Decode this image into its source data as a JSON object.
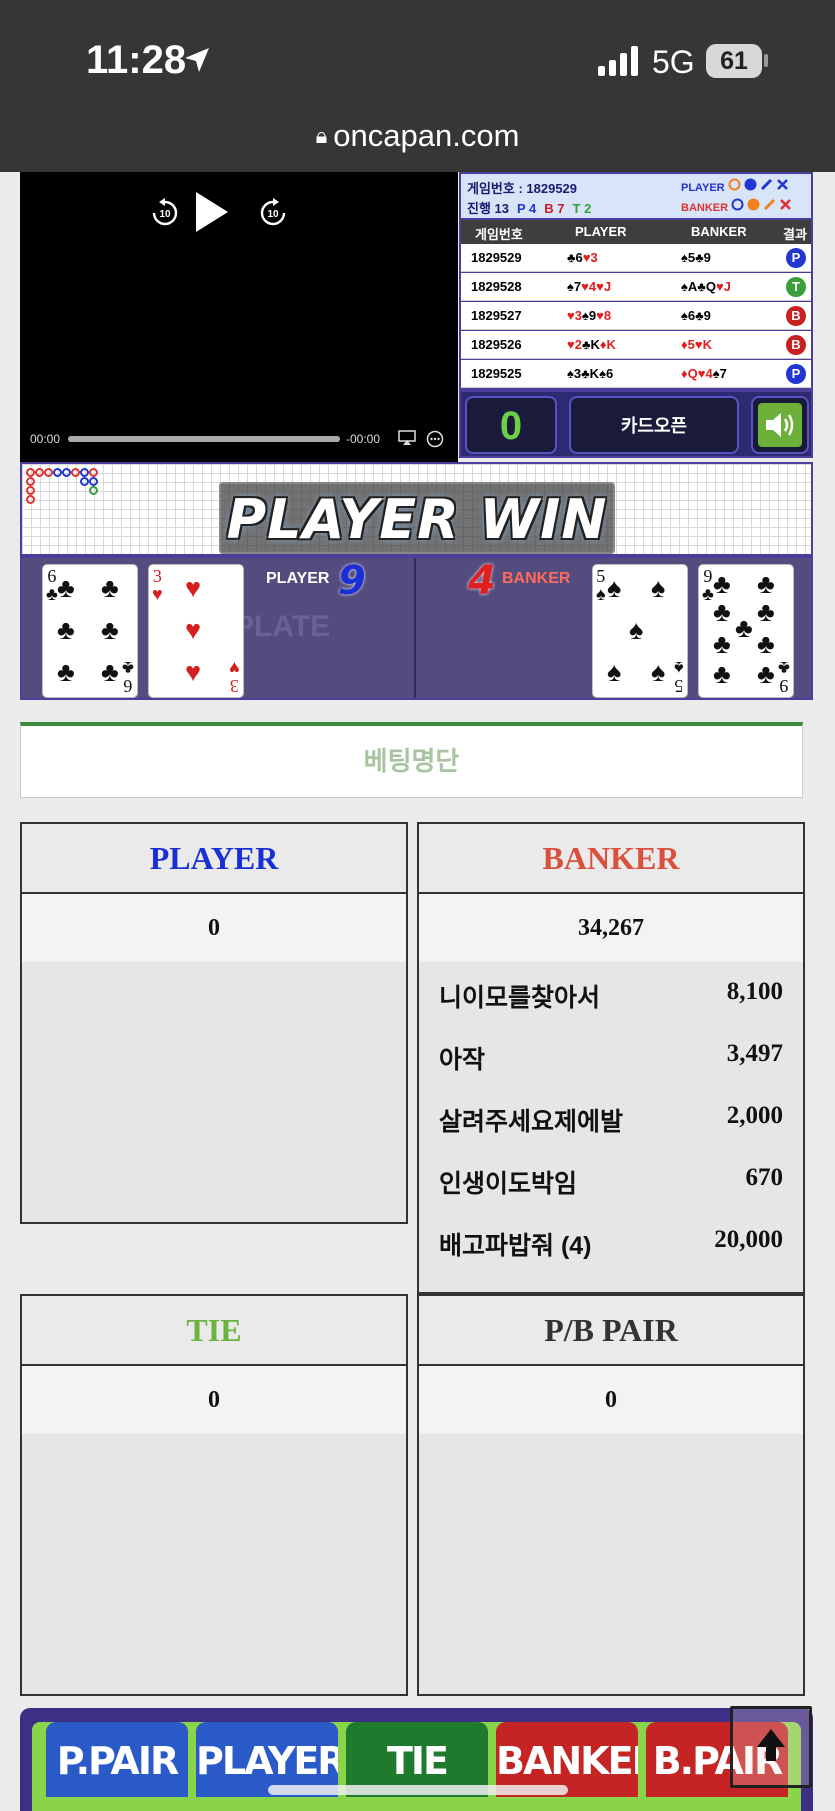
{
  "status": {
    "time": "11:28",
    "network": "5G",
    "battery": "61"
  },
  "browser": {
    "url": "oncapan.com"
  },
  "video": {
    "time_current": "00:00",
    "time_remaining": "-00:00",
    "skip_back": "10",
    "skip_forward": "10"
  },
  "panel": {
    "game_no_label": "게임번호 : 1829529",
    "progress_label": "진행 13",
    "p_count": "P 4",
    "b_count": "B 7",
    "t_count": "T 2",
    "player_tag": "PLAYER",
    "banker_tag": "BANKER",
    "columns": [
      "게임번호",
      "PLAYER",
      "BANKER",
      "결과"
    ],
    "rows": [
      {
        "no": "1829529",
        "player": [
          [
            "♣6",
            "b"
          ],
          [
            "♥3",
            "r"
          ]
        ],
        "banker": [
          [
            "♠5",
            "b"
          ],
          [
            "♣9",
            "b"
          ]
        ],
        "result": "P"
      },
      {
        "no": "1829528",
        "player": [
          [
            "♠7",
            "b"
          ],
          [
            "♥4",
            "r"
          ],
          [
            "♥J",
            "r"
          ]
        ],
        "banker": [
          [
            "♠A",
            "b"
          ],
          [
            "♣Q",
            "b"
          ],
          [
            "♥J",
            "r"
          ]
        ],
        "result": "T"
      },
      {
        "no": "1829527",
        "player": [
          [
            "♥3",
            "r"
          ],
          [
            "♠9",
            "b"
          ],
          [
            "♥8",
            "r"
          ]
        ],
        "banker": [
          [
            "♠6",
            "b"
          ],
          [
            "♣9",
            "b"
          ]
        ],
        "result": "B"
      },
      {
        "no": "1829526",
        "player": [
          [
            "♥2",
            "r"
          ],
          [
            "♣K",
            "b"
          ],
          [
            "♦K",
            "r"
          ]
        ],
        "banker": [
          [
            "♦5",
            "r"
          ],
          [
            "♥K",
            "r"
          ]
        ],
        "result": "B"
      },
      {
        "no": "1829525",
        "player": [
          [
            "♠3",
            "b"
          ],
          [
            "♣K",
            "b"
          ],
          [
            "♠6",
            "b"
          ]
        ],
        "banker": [
          [
            "♦Q",
            "r"
          ],
          [
            "♥4",
            "r"
          ],
          [
            "♠7",
            "b"
          ]
        ],
        "result": "P"
      }
    ],
    "counter": "0",
    "card_open": "카드오픈"
  },
  "banner": {
    "text": "PLAYER WIN"
  },
  "table": {
    "player_label": "PLAYER",
    "player_score": "9",
    "banker_label": "BANKER",
    "banker_score": "4",
    "plate_text": "PLATE"
  },
  "betting": {
    "title": "베팅명단",
    "player": {
      "label": "PLAYER",
      "total": "0",
      "color": "#1a2fd6"
    },
    "banker": {
      "label": "BANKER",
      "total": "34,267",
      "color": "#d9503c",
      "rows": [
        {
          "name": "니이모를찾아서",
          "amount": "8,100"
        },
        {
          "name": "아작",
          "amount": "3,497"
        },
        {
          "name": "살려주세요제에발",
          "amount": "2,000"
        },
        {
          "name": "인생이도박임",
          "amount": "670"
        },
        {
          "name": "배고파밥줘 (4)",
          "amount": "20,000"
        }
      ]
    },
    "tie": {
      "label": "TIE",
      "total": "0",
      "color": "#6db33f"
    },
    "pair": {
      "label": "P/B PAIR",
      "total": "0",
      "color": "#333333"
    }
  },
  "bet_buttons": [
    "P.PAIR",
    "PLAYER",
    "TIE",
    "BANKER",
    "B.PAIR"
  ]
}
